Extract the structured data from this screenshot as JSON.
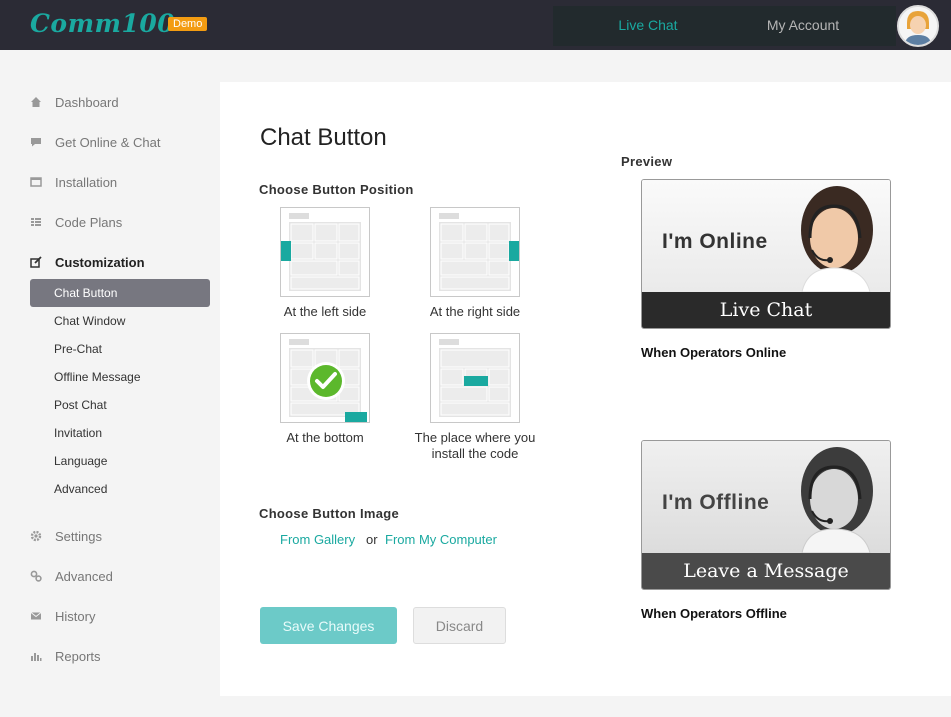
{
  "header": {
    "logo": "Comm100",
    "badge": "Demo",
    "nav": {
      "live_chat": "Live Chat",
      "my_account": "My Account"
    }
  },
  "sidebar": {
    "items": [
      {
        "label": "Dashboard",
        "icon": "home-icon"
      },
      {
        "label": "Get Online & Chat",
        "icon": "chat-bubble-icon"
      },
      {
        "label": "Installation",
        "icon": "window-icon"
      },
      {
        "label": "Code Plans",
        "icon": "list-icon"
      },
      {
        "label": "Customization",
        "icon": "edit-icon"
      },
      {
        "label": "Settings",
        "icon": "gear-icon"
      },
      {
        "label": "Advanced",
        "icon": "gears-icon"
      },
      {
        "label": "History",
        "icon": "mail-icon"
      },
      {
        "label": "Reports",
        "icon": "bar-chart-icon"
      }
    ],
    "sub_items": [
      "Chat Button",
      "Chat Window",
      "Pre-Chat",
      "Offline Message",
      "Post Chat",
      "Invitation",
      "Language",
      "Advanced"
    ]
  },
  "main": {
    "title": "Chat Button",
    "position_label": "Choose Button Position",
    "positions": [
      "At the left side",
      "At the right side",
      "At the bottom",
      "The place where you install the code"
    ],
    "selected_position": "At the bottom",
    "image_label": "Choose Button Image",
    "from_gallery": "From Gallery",
    "or": "or",
    "from_computer": "From My Computer",
    "save": "Save Changes",
    "discard": "Discard"
  },
  "preview": {
    "label": "Preview",
    "online_status": "I'm Online",
    "online_bar": "Live Chat",
    "online_caption": "When Operators Online",
    "offline_status": "I'm Offline",
    "offline_bar": "Leave a Message",
    "offline_caption": "When Operators Offline"
  },
  "colors": {
    "accent": "#1aa9a0",
    "topbar": "#2b2b35",
    "selected_sub": "#777780",
    "save_button": "#6ccac8",
    "badge": "#f39c12"
  }
}
